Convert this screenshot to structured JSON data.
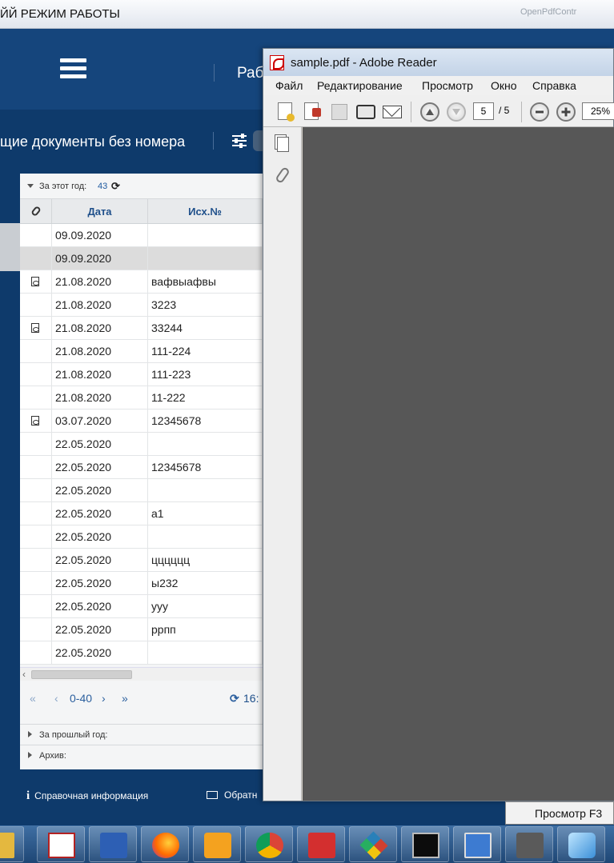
{
  "top_title": "ЙЙ РЕЖИМ РАБОТЫ",
  "ghost_text": "OpenPdfContr",
  "app": {
    "work_title": "Раб",
    "doc_title": "щие документы без номера",
    "group_label": "За этот год:",
    "group_count": "43",
    "columns": {
      "date": "Дата",
      "out_no": "Исх.№"
    },
    "rows": [
      {
        "date": "09.09.2020",
        "num": "",
        "attach": false,
        "selected": false
      },
      {
        "date": "09.09.2020",
        "num": "",
        "attach": false,
        "selected": true
      },
      {
        "date": "21.08.2020",
        "num": "вафвыафвы",
        "attach": true,
        "selected": false
      },
      {
        "date": "21.08.2020",
        "num": "3223",
        "attach": false,
        "selected": false
      },
      {
        "date": "21.08.2020",
        "num": "33244",
        "attach": true,
        "selected": false
      },
      {
        "date": "21.08.2020",
        "num": "111-224",
        "attach": false,
        "selected": false
      },
      {
        "date": "21.08.2020",
        "num": "111-223",
        "attach": false,
        "selected": false
      },
      {
        "date": "21.08.2020",
        "num": "11-222",
        "attach": false,
        "selected": false
      },
      {
        "date": "03.07.2020",
        "num": "12345678",
        "attach": true,
        "selected": false
      },
      {
        "date": "22.05.2020",
        "num": "",
        "attach": false,
        "selected": false
      },
      {
        "date": "22.05.2020",
        "num": "12345678",
        "attach": false,
        "selected": false
      },
      {
        "date": "22.05.2020",
        "num": "",
        "attach": false,
        "selected": false
      },
      {
        "date": "22.05.2020",
        "num": "а1",
        "attach": false,
        "selected": false
      },
      {
        "date": "22.05.2020",
        "num": "",
        "attach": false,
        "selected": false
      },
      {
        "date": "22.05.2020",
        "num": "цццццц",
        "attach": false,
        "selected": false
      },
      {
        "date": "22.05.2020",
        "num": "ы232",
        "attach": false,
        "selected": false
      },
      {
        "date": "22.05.2020",
        "num": "ууу",
        "attach": false,
        "selected": false
      },
      {
        "date": "22.05.2020",
        "num": "ррпп",
        "attach": false,
        "selected": false
      },
      {
        "date": "22.05.2020",
        "num": "",
        "attach": false,
        "selected": false
      }
    ],
    "pager": {
      "first": "«",
      "prev": "‹",
      "range": "0-40",
      "next": "›",
      "last": "»",
      "time": "16:"
    },
    "last_year": "За прошлый год:",
    "archive": "Архив:",
    "footer_info": "Справочная информация",
    "footer_feedback": "Обратн"
  },
  "reader": {
    "title": "sample.pdf - Adobe Reader",
    "menu": [
      "Файл",
      "Редактирование",
      "Просмотр",
      "Окно",
      "Справка"
    ],
    "page": "5",
    "total": "/ 5",
    "zoom": "25%"
  },
  "tooltip": "Просмотр F3",
  "colors": {
    "app_blue": "#15457c",
    "app_dark": "#0e3a6b",
    "reader_canvas": "#575757",
    "link": "#1e5aa0"
  },
  "taskbar_icons": [
    "folder-icon",
    "pdf-xchange-icon",
    "word-icon",
    "firefox-icon",
    "outlook-icon",
    "chrome-icon",
    "xmind-icon",
    "gem-icon",
    "cmd-icon",
    "network-icon",
    "sync-icon",
    "cube-icon"
  ]
}
